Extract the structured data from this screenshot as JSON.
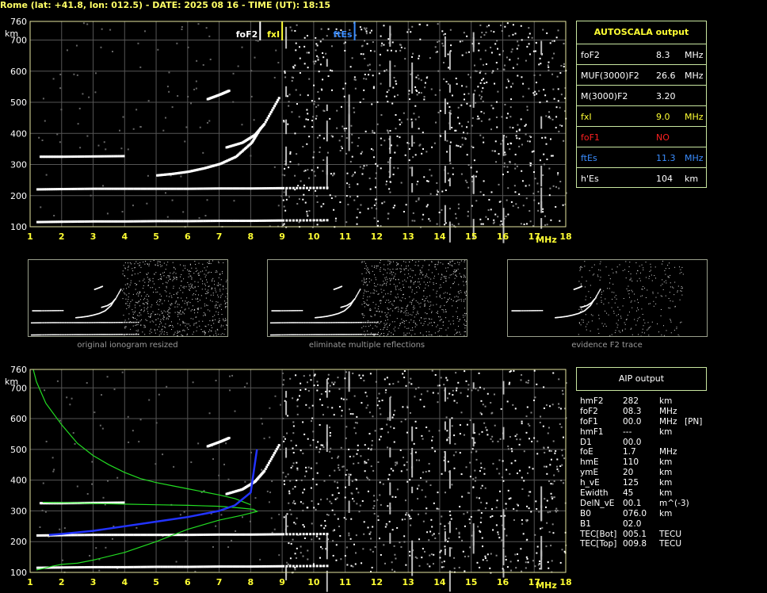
{
  "header": "Rome (lat: +41.8, lon: 012.5) - DATE: 2025 08 16 - TIME (UT): 18:15",
  "autoscala": {
    "title": "AUTOSCALA output",
    "rows": [
      {
        "label": "foF2",
        "value": "8.3",
        "unit": "MHz",
        "color": "#ffffff"
      },
      {
        "label": "MUF(3000)F2",
        "value": "26.6",
        "unit": "MHz",
        "color": "#ffffff"
      },
      {
        "label": "M(3000)F2",
        "value": "3.20",
        "unit": "",
        "color": "#ffffff"
      },
      {
        "label": "fxI",
        "value": "9.0",
        "unit": "MHz",
        "color": "#ffff33"
      },
      {
        "label": "foF1",
        "value": "NO",
        "unit": "",
        "color": "#ff2020"
      },
      {
        "label": "ftEs",
        "value": "11.3",
        "unit": "MHz",
        "color": "#3a8dff"
      },
      {
        "label": "h'Es",
        "value": "104",
        "unit": "km",
        "color": "#ffffff"
      }
    ]
  },
  "aip": {
    "title": "AIP output",
    "rows": [
      {
        "label": "hmF2",
        "value": "282",
        "unit": "km",
        "extra": ""
      },
      {
        "label": "foF2",
        "value": "08.3",
        "unit": "MHz",
        "extra": ""
      },
      {
        "label": "foF1",
        "value": "00.0",
        "unit": "MHz",
        "extra": "[PN]"
      },
      {
        "label": "hmF1",
        "value": "---",
        "unit": "km",
        "extra": ""
      },
      {
        "label": "D1",
        "value": "00.0",
        "unit": "",
        "extra": ""
      },
      {
        "label": "foE",
        "value": "1.7",
        "unit": "MHz",
        "extra": ""
      },
      {
        "label": "hmE",
        "value": "110",
        "unit": "km",
        "extra": ""
      },
      {
        "label": "ymE",
        "value": "20",
        "unit": "km",
        "extra": ""
      },
      {
        "label": "h_vE",
        "value": "125",
        "unit": "km",
        "extra": ""
      },
      {
        "label": "Ewidth",
        "value": "45",
        "unit": "km",
        "extra": ""
      },
      {
        "label": "DelN_vE",
        "value": "00.1",
        "unit": "m^(-3)",
        "extra": ""
      },
      {
        "label": "B0",
        "value": "076.0",
        "unit": "km",
        "extra": ""
      },
      {
        "label": "B1",
        "value": "02.0",
        "unit": "",
        "extra": ""
      },
      {
        "label": "TEC[Bot]",
        "value": "005.1",
        "unit": "TECU",
        "extra": ""
      },
      {
        "label": "TEC[Top]",
        "value": "009.8",
        "unit": "TECU",
        "extra": ""
      }
    ]
  },
  "thumbnails": [
    {
      "caption": "original ionogram resized"
    },
    {
      "caption": "eliminate multiple reflections"
    },
    {
      "caption": "evidence F2 trace"
    }
  ],
  "chart_data": [
    {
      "type": "scatter",
      "xlabel": "MHz",
      "ylabel": "km",
      "xlim": [
        1,
        18
      ],
      "ylim": [
        100,
        760
      ],
      "xticks": [
        "1",
        "2",
        "3",
        "4",
        "5",
        "6",
        "7",
        "8",
        "9",
        "10",
        "11",
        "12",
        "13",
        "14",
        "15",
        "16",
        "17",
        "18"
      ],
      "yticks": [
        "100",
        "200",
        "300",
        "400",
        "500",
        "600",
        "700",
        "760"
      ],
      "markers": [
        {
          "label": "foF2",
          "x": 8.3,
          "color": "#ffffff"
        },
        {
          "label": "fxI",
          "x": 9.0,
          "color": "#ffff33"
        },
        {
          "label": "ftEs",
          "x": 11.3,
          "color": "#3a8dff"
        }
      ],
      "traces": [
        {
          "name": "",
          "x": [
            1.2,
            2,
            3,
            4,
            5,
            6,
            7,
            8,
            9,
            10.5
          ],
          "y": [
            115,
            116,
            117,
            117,
            118,
            118,
            119,
            119,
            120,
            121
          ]
        },
        {
          "name": "",
          "x": [
            1.2,
            2,
            3,
            4,
            5,
            6,
            7,
            8,
            9,
            10.5
          ],
          "y": [
            220,
            221,
            222,
            222,
            222,
            222,
            223,
            223,
            224,
            225
          ]
        },
        {
          "name": "",
          "x": [
            5,
            5.5,
            6,
            6.5,
            7,
            7.5,
            8,
            8.3
          ],
          "y": [
            265,
            270,
            277,
            288,
            302,
            325,
            370,
            420
          ]
        },
        {
          "name": "",
          "x": [
            7.2,
            7.7,
            8.1,
            8.4,
            8.9
          ],
          "y": [
            355,
            370,
            395,
            430,
            520
          ]
        },
        {
          "name": "",
          "x": [
            1.3,
            2,
            3,
            4
          ],
          "y": [
            325,
            325,
            326,
            327
          ]
        },
        {
          "name": "",
          "x": [
            6.6,
            7,
            7.3
          ],
          "y": [
            510,
            525,
            538
          ]
        }
      ],
      "grid": true
    },
    {
      "type": "line",
      "xlabel": "MHz",
      "ylabel": "km",
      "xlim": [
        1,
        18
      ],
      "ylim": [
        100,
        760
      ],
      "xticks": [
        "1",
        "2",
        "3",
        "4",
        "5",
        "6",
        "7",
        "8",
        "9",
        "10",
        "11",
        "12",
        "13",
        "14",
        "15",
        "16",
        "17",
        "18"
      ],
      "yticks": [
        "100",
        "200",
        "300",
        "400",
        "500",
        "600",
        "700",
        "760"
      ],
      "series": [
        {
          "name": "",
          "color": "#22dd22",
          "x": [
            1.1,
            1.2,
            1.5,
            2,
            2.5,
            3,
            3.5,
            4,
            4.5,
            5,
            5.5,
            6,
            6.5,
            7,
            7.5,
            8
          ],
          "y": [
            760,
            720,
            650,
            580,
            520,
            480,
            450,
            425,
            405,
            392,
            382,
            372,
            362,
            352,
            340,
            320
          ]
        },
        {
          "name": "",
          "color": "#22dd22",
          "x": [
            1.2,
            1.4,
            1.7,
            2,
            2.5,
            3,
            4,
            5,
            6,
            7,
            7.7,
            8.2,
            8.1,
            7.6,
            7,
            6,
            5,
            4,
            3,
            2.5,
            2,
            1.7,
            1.5,
            1.4
          ],
          "y": [
            108,
            112,
            120,
            126,
            130,
            140,
            165,
            200,
            240,
            270,
            285,
            298,
            305,
            310,
            315,
            318,
            320,
            322,
            324,
            326,
            327,
            327,
            328,
            328
          ]
        },
        {
          "name": "",
          "color": "#2233ff",
          "x": [
            1.6,
            2,
            3,
            4,
            5,
            6,
            7,
            7.5,
            8,
            8.2
          ],
          "y": [
            222,
            225,
            235,
            250,
            265,
            280,
            300,
            318,
            360,
            500
          ]
        }
      ],
      "traces": [
        {
          "name": "",
          "x": [
            1.2,
            2,
            3,
            4,
            5,
            6,
            7,
            8,
            9,
            10.5
          ],
          "y": [
            115,
            116,
            117,
            117,
            118,
            118,
            119,
            119,
            120,
            121
          ]
        },
        {
          "name": "",
          "x": [
            1.2,
            2,
            3,
            4,
            5,
            6,
            7,
            8,
            9,
            10.5
          ],
          "y": [
            220,
            221,
            222,
            222,
            222,
            222,
            223,
            223,
            224,
            225
          ]
        },
        {
          "name": "",
          "x": [
            7.2,
            7.7,
            8.1,
            8.4,
            8.9
          ],
          "y": [
            355,
            370,
            395,
            430,
            520
          ]
        },
        {
          "name": "",
          "x": [
            1.3,
            2,
            3,
            4
          ],
          "y": [
            325,
            325,
            326,
            327
          ]
        },
        {
          "name": "",
          "x": [
            6.6,
            7,
            7.3
          ],
          "y": [
            510,
            525,
            538
          ]
        }
      ],
      "grid": true
    }
  ]
}
